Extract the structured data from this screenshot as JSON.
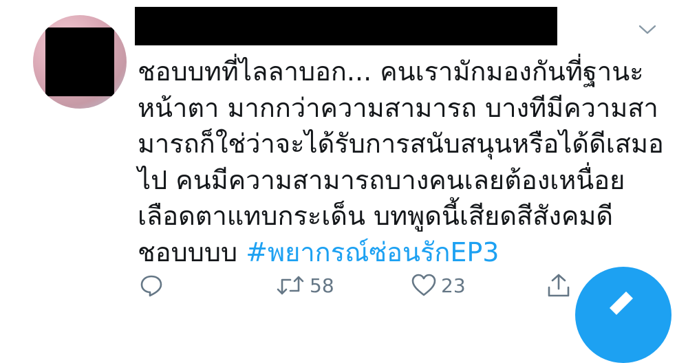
{
  "tweet": {
    "lines": [
      "ชอบบทที่ไลลาบอก... คนเรามักมองกันที่ฐานะ",
      "หน้าตา มากกว่าความสามารถ บางทีมีความสา",
      "มารถก็ใช่ว่าจะได้รับการสนับสนุนหรือได้ดีเสมอ",
      "ไป คนมีความสามารถบางคนเลยต้องเหนื่อย",
      "เลือดตาแทบกระเด็น บทพูดนี้เสียดสีสังคมดี",
      "ชอบบบบ "
    ],
    "hashtag": "#พยากรณ์ซ่อนรักEP3"
  },
  "actions": {
    "reply_icon": "reply-icon",
    "retweet_icon": "retweet-icon",
    "retweet_count": "58",
    "like_icon": "heart-icon",
    "like_count": "23",
    "share_icon": "share-icon"
  },
  "colors": {
    "text": "#14171a",
    "hashtag": "#1da1f2",
    "icon": "#657786",
    "fab": "#1da1f2"
  }
}
